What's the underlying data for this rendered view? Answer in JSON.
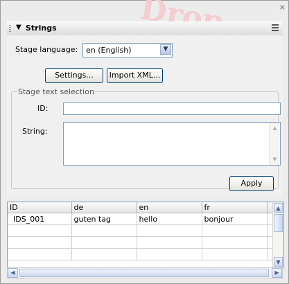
{
  "panel": {
    "close_glyph": "×",
    "watermark": "Drop",
    "title": "Strings",
    "collapse_icon": "triangle-down-icon",
    "menu_icon": "panel-options-icon"
  },
  "stage": {
    "label": "Stage language:",
    "selected": "en (English)"
  },
  "buttons": {
    "settings": "Settings...",
    "import_xml": "Import XML...",
    "apply": "Apply"
  },
  "selection": {
    "group_label": "Stage text selection",
    "id_label": "ID:",
    "id_value": "",
    "string_label": "String:",
    "string_value": ""
  },
  "table": {
    "columns": [
      "ID",
      "de",
      "en",
      "fr"
    ],
    "rows": [
      [
        "IDS_001",
        "guten tag",
        "hello",
        "bonjour"
      ],
      [
        "",
        "",
        "",
        ""
      ],
      [
        "",
        "",
        "",
        ""
      ],
      [
        "",
        "",
        "",
        ""
      ]
    ]
  }
}
